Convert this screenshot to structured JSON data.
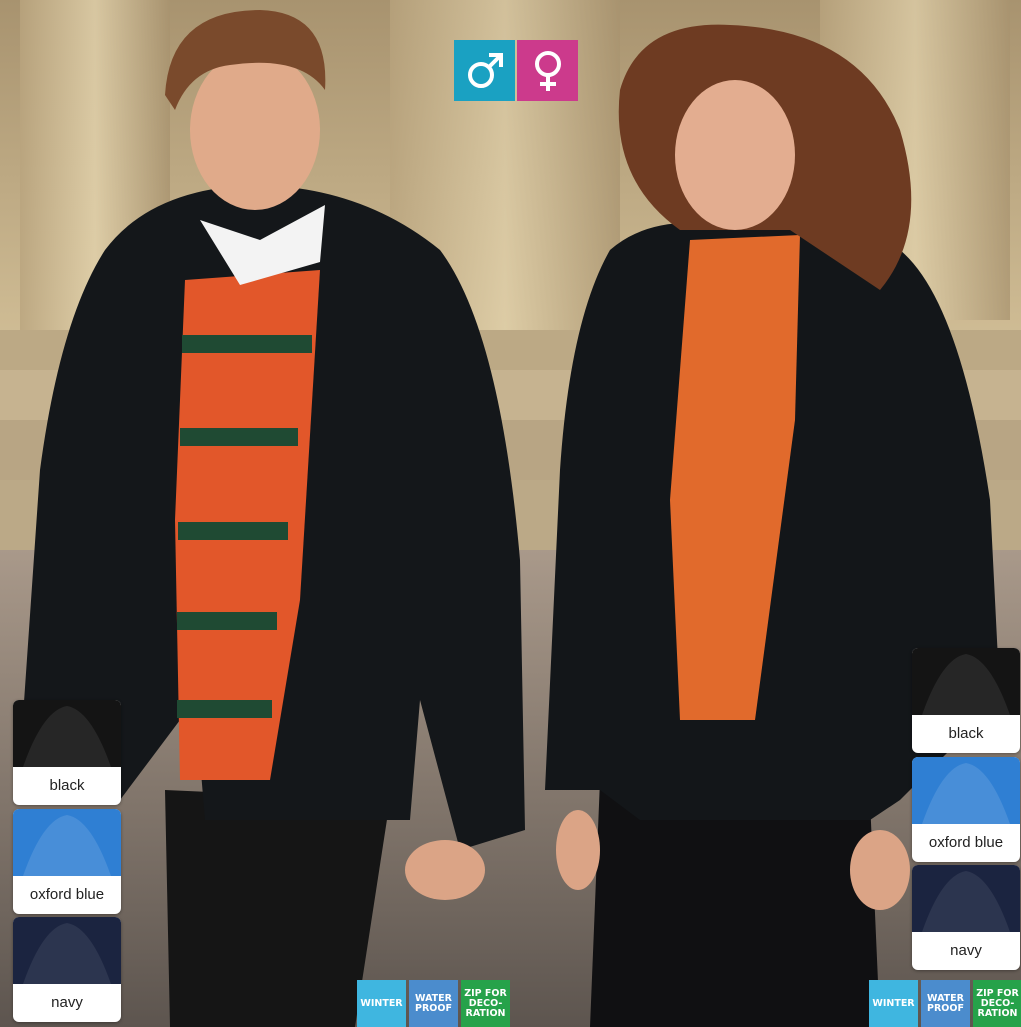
{
  "gender_icons": [
    {
      "icon": "male-symbol-icon",
      "color": "#1aa1c2"
    },
    {
      "icon": "female-symbol-icon",
      "color": "#cc3a8c"
    }
  ],
  "left_swatches": [
    {
      "label": "black",
      "color": "#141414"
    },
    {
      "label": "oxford blue",
      "color": "#2f7fd3"
    },
    {
      "label": "navy",
      "color": "#1b2440"
    }
  ],
  "right_swatches": [
    {
      "label": "black",
      "color": "#141414"
    },
    {
      "label": "oxford blue",
      "color": "#2f7fd3"
    },
    {
      "label": "navy",
      "color": "#1b2440"
    }
  ],
  "badges_left": [
    {
      "label": "WINTER",
      "color": "#3fb6e0"
    },
    {
      "label": "WATER\nPROOF",
      "color": "#4b8ccd"
    },
    {
      "label": "ZIP FOR\nDECO-\nRATION",
      "color": "#26a24a"
    }
  ],
  "badges_right": [
    {
      "label": "WINTER",
      "color": "#3fb6e0"
    },
    {
      "label": "WATER\nPROOF",
      "color": "#4b8ccd"
    },
    {
      "label": "ZIP FOR\nDECO-\nRATION",
      "color": "#26a24a"
    }
  ]
}
